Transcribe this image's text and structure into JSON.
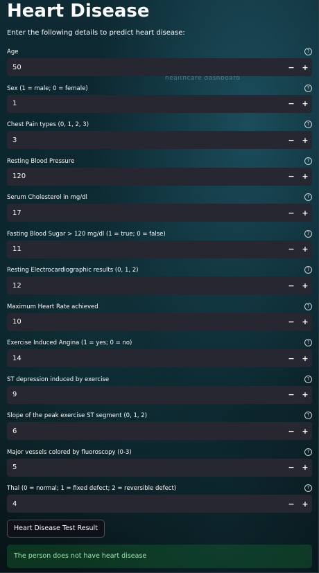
{
  "page": {
    "title": "Heart Disease",
    "subtitle": "Enter the following details to predict heart disease:",
    "background_text": "healthcare dashboard"
  },
  "fields": [
    {
      "label": "Age",
      "value": "50"
    },
    {
      "label": "Sex (1 = male; 0 = female)",
      "value": "1"
    },
    {
      "label": "Chest Pain types (0, 1, 2, 3)",
      "value": "3"
    },
    {
      "label": "Resting Blood Pressure",
      "value": "120"
    },
    {
      "label": "Serum Cholesterol in mg/dl",
      "value": "17"
    },
    {
      "label": "Fasting Blood Sugar > 120 mg/dl (1 = true; 0 = false)",
      "value": "11"
    },
    {
      "label": "Resting Electrocardiographic results (0, 1, 2)",
      "value": "12"
    },
    {
      "label": "Maximum Heart Rate achieved",
      "value": "10"
    },
    {
      "label": "Exercise Induced Angina (1 = yes; 0 = no)",
      "value": "14"
    },
    {
      "label": "ST depression induced by exercise",
      "value": "9"
    },
    {
      "label": "Slope of the peak exercise ST segment (0, 1, 2)",
      "value": "6"
    },
    {
      "label": "Major vessels colored by fluoroscopy (0-3)",
      "value": "5"
    },
    {
      "label": "Thal (0 = normal; 1 = fixed defect; 2 = reversible defect)",
      "value": "4"
    }
  ],
  "controls": {
    "minus": "−",
    "plus": "+",
    "help": "?"
  },
  "button": {
    "label": "Heart Disease Test Result"
  },
  "result": {
    "text": "The person does not have heart disease"
  },
  "colors": {
    "input_bg": "#262730",
    "success_bg": "#1f5a3a",
    "success_text": "#9fe3b0"
  }
}
